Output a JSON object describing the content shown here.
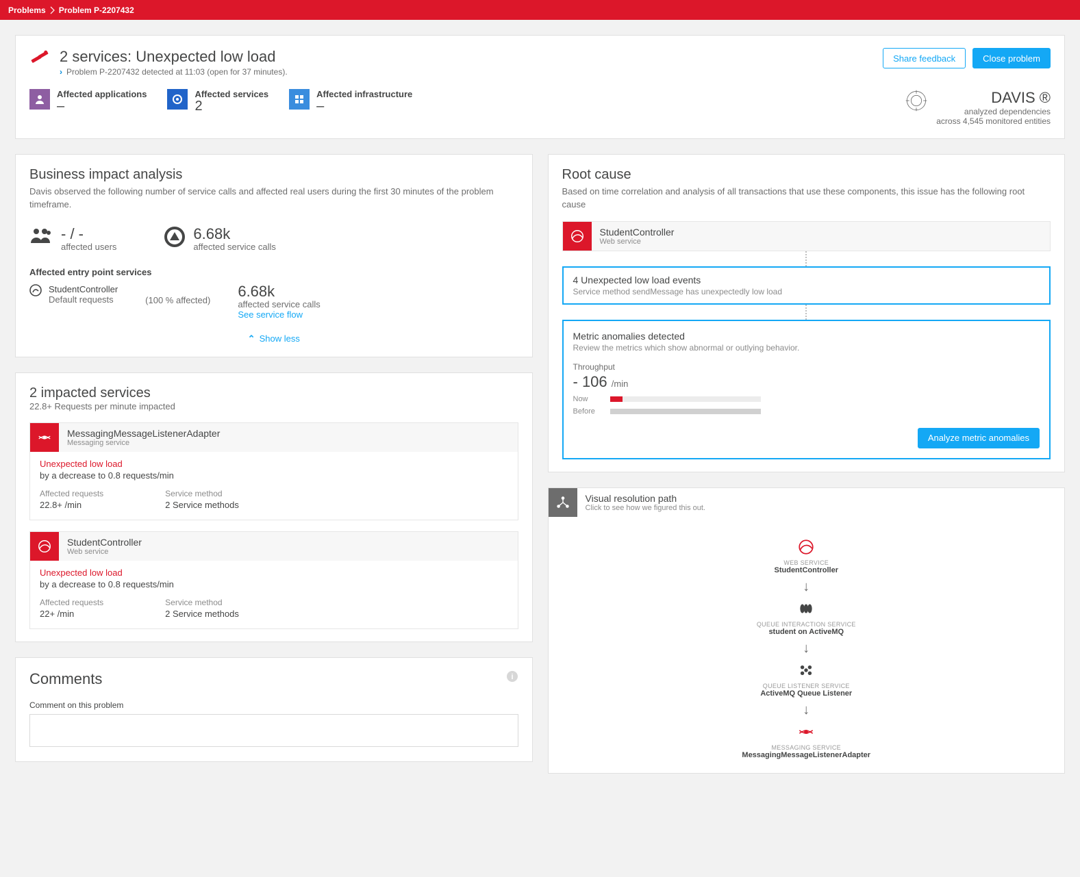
{
  "breadcrumb": {
    "root": "Problems",
    "current": "Problem P-2207432"
  },
  "header": {
    "title": "2 services: Unexpected low load",
    "subtitle": "Problem P-2207432 detected at 11:03 (open for 37 minutes).",
    "share_btn": "Share feedback",
    "close_btn": "Close problem"
  },
  "summary": {
    "apps_label": "Affected applications",
    "apps_val": "–",
    "svcs_label": "Affected services",
    "svcs_val": "2",
    "infra_label": "Affected infrastructure",
    "infra_val": "–",
    "davis_name": "DAVIS ®",
    "davis_l1": "analyzed dependencies",
    "davis_l2": "across 4,545 monitored entities"
  },
  "bia": {
    "title": "Business impact analysis",
    "desc": "Davis observed the following number of service calls and affected real users during the first 30 minutes of the problem timeframe.",
    "users_val": "- / -",
    "users_lbl": "affected users",
    "calls_val": "6.68k",
    "calls_lbl": "affected service calls",
    "entry_head": "Affected entry point services",
    "entry_name": "StudentController",
    "entry_sub": "Default requests",
    "entry_pct": "(100 % affected)",
    "entry_calls": "6.68k",
    "entry_calls_lbl": "affected service calls",
    "flow_link": "See service flow",
    "showless": "Show less"
  },
  "impacted": {
    "title": "2 impacted services",
    "sub": "22.8+ Requests per minute impacted",
    "cards": [
      {
        "name": "MessagingMessageListenerAdapter",
        "type": "Messaging service",
        "alert": "Unexpected low load",
        "alert_sub": "by a decrease to 0.8 requests/min",
        "req_h": "Affected requests",
        "req_v": "22.8+ /min",
        "m_h": "Service method",
        "m_v": "2 Service methods"
      },
      {
        "name": "StudentController",
        "type": "Web service",
        "alert": "Unexpected low load",
        "alert_sub": "by a decrease to 0.8 requests/min",
        "req_h": "Affected requests",
        "req_v": "22+ /min",
        "m_h": "Service method",
        "m_v": "2 Service methods"
      }
    ]
  },
  "comments": {
    "title": "Comments",
    "label": "Comment on this problem"
  },
  "root": {
    "title": "Root cause",
    "desc": "Based on time correlation and analysis of all transactions that use these components, this issue has the following root cause",
    "svc_name": "StudentController",
    "svc_type": "Web service",
    "events_t": "4 Unexpected low load events",
    "events_s": "Service method sendMessage has unexpectedly low load",
    "anom_t": "Metric anomalies detected",
    "anom_s": "Review the metrics which show abnormal or outlying behavior.",
    "thru_lbl": "Throughput",
    "thru_val": "- 106",
    "thru_unit": "/min",
    "now": "Now",
    "before": "Before",
    "analyze": "Analyze metric anomalies"
  },
  "vrp": {
    "title": "Visual resolution path",
    "sub": "Click to see how we figured this out.",
    "nodes": [
      {
        "cat": "WEB SERVICE",
        "name": "StudentController"
      },
      {
        "cat": "QUEUE INTERACTION SERVICE",
        "name": "student on ActiveMQ"
      },
      {
        "cat": "QUEUE LISTENER SERVICE",
        "name": "ActiveMQ Queue Listener"
      },
      {
        "cat": "MESSAGING SERVICE",
        "name": "MessagingMessageListenerAdapter"
      }
    ]
  }
}
